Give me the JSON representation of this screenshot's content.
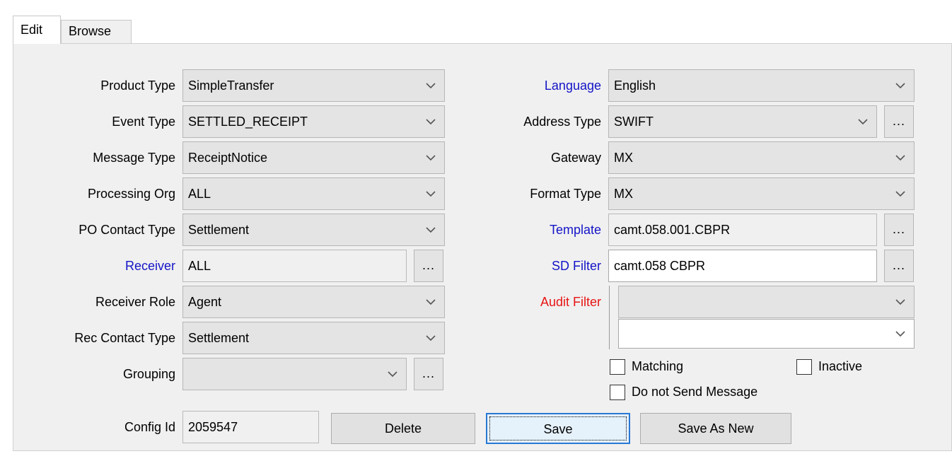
{
  "tabs": {
    "edit": "Edit",
    "browse": "Browse"
  },
  "left": {
    "product_type": {
      "label": "Product Type",
      "value": "SimpleTransfer"
    },
    "event_type": {
      "label": "Event Type",
      "value": "SETTLED_RECEIPT"
    },
    "message_type": {
      "label": "Message Type",
      "value": "ReceiptNotice"
    },
    "processing_org": {
      "label": "Processing Org",
      "value": "ALL"
    },
    "po_contact_type": {
      "label": "PO Contact Type",
      "value": "Settlement"
    },
    "receiver": {
      "label": "Receiver",
      "value": "ALL"
    },
    "receiver_role": {
      "label": "Receiver Role",
      "value": "Agent"
    },
    "rec_contact_type": {
      "label": "Rec Contact Type",
      "value": "Settlement"
    },
    "grouping": {
      "label": "Grouping",
      "value": ""
    },
    "config_id": {
      "label": "Config Id",
      "value": "2059547"
    }
  },
  "right": {
    "language": {
      "label": "Language",
      "value": "English"
    },
    "address_type": {
      "label": "Address Type",
      "value": "SWIFT"
    },
    "gateway": {
      "label": "Gateway",
      "value": "MX"
    },
    "format_type": {
      "label": "Format Type",
      "value": "MX"
    },
    "template": {
      "label": "Template",
      "value": "camt.058.001.CBPR"
    },
    "sd_filter": {
      "label": "SD Filter",
      "value": "camt.058 CBPR"
    },
    "audit_filter": {
      "label": "Audit Filter",
      "value": "",
      "value2": ""
    },
    "matching": "Matching",
    "inactive": "Inactive",
    "do_not_send": "Do not Send Message"
  },
  "ellipsis": "...",
  "buttons": {
    "delete": "Delete",
    "save": "Save",
    "save_as_new": "Save As New"
  },
  "colors": {
    "link_label": "#1414c8",
    "required_label": "#e81414",
    "focus": "#2a78d4"
  },
  "icons": {
    "dropdown": "chevron-down-icon"
  }
}
